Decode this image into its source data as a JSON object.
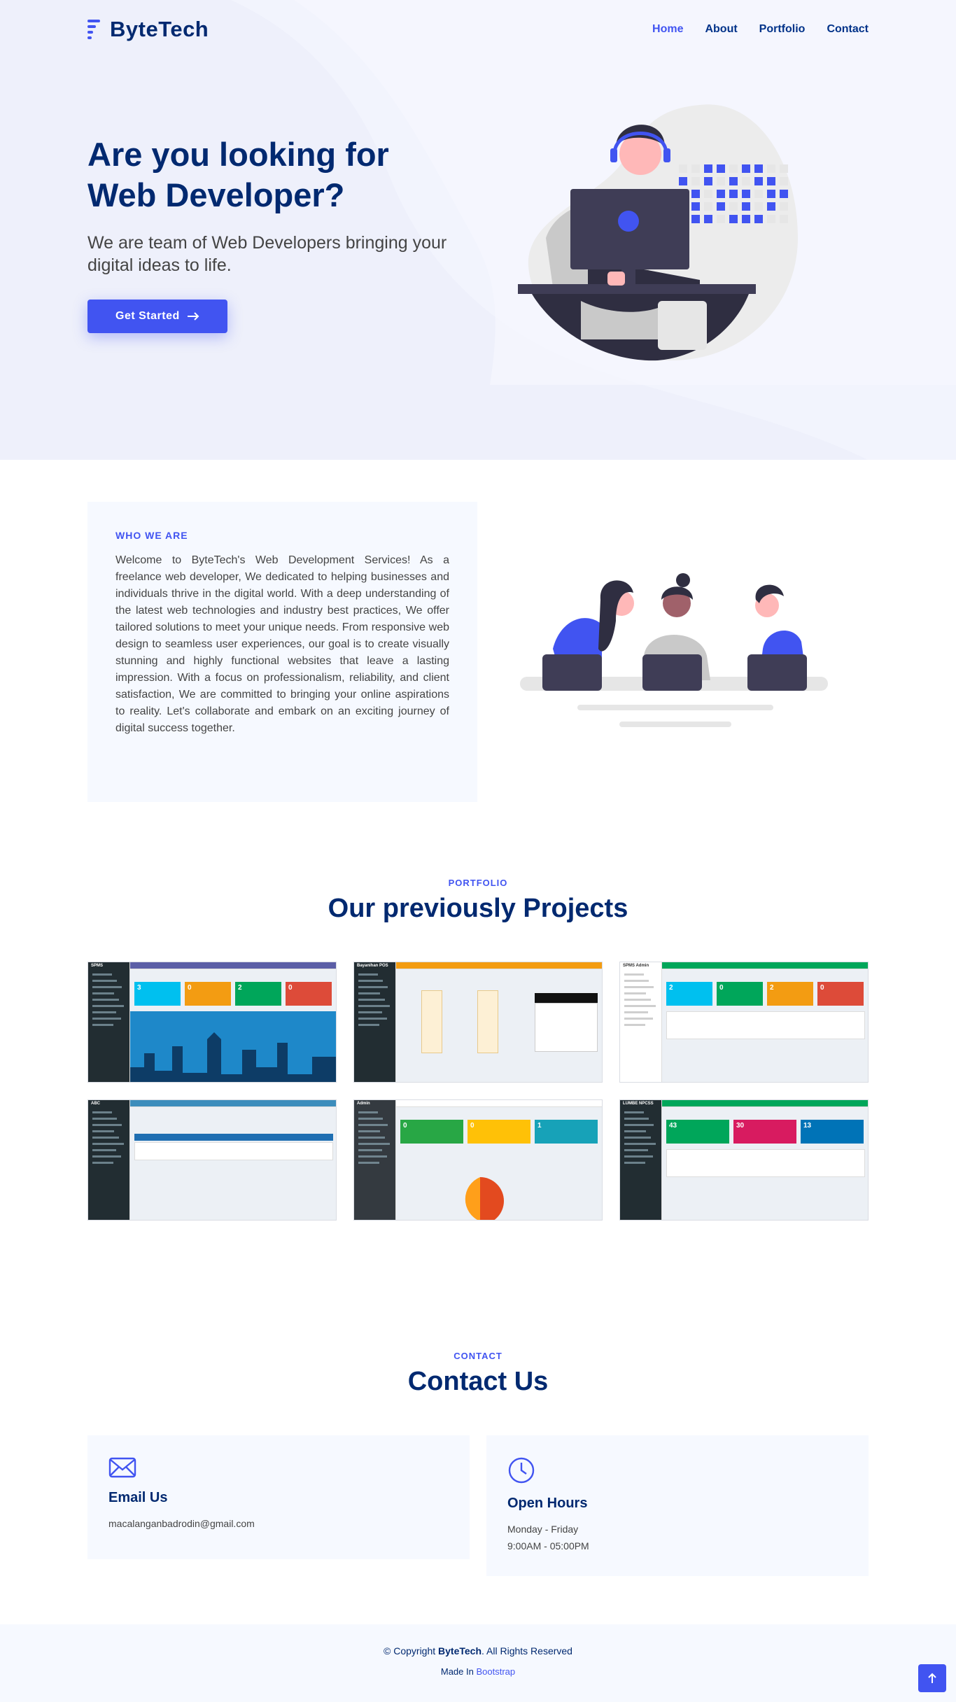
{
  "brand": {
    "name": "ByteTech"
  },
  "nav": [
    {
      "label": "Home",
      "active": true
    },
    {
      "label": "About",
      "active": false
    },
    {
      "label": "Portfolio",
      "active": false
    },
    {
      "label": "Contact",
      "active": false
    }
  ],
  "hero": {
    "title_line1": "Are you looking for",
    "title_line2": "Web Developer?",
    "subtitle": "We are team of Web Developers bringing your digital ideas to life.",
    "cta": "Get Started"
  },
  "about": {
    "tag": "WHO WE ARE",
    "text": "Welcome to ByteTech's Web Development Services! As a freelance web developer, We dedicated to helping businesses and individuals thrive in the digital world. With a deep understanding of the latest web technologies and industry best practices, We offer tailored solutions to meet your unique needs. From responsive web design to seamless user experiences, our goal is to create visually stunning and highly functional websites that leave a lasting impression. With a focus on professionalism, reliability, and client satisfaction, We are committed to bringing your online aspirations to reality. Let's collaborate and embark on an exciting journey of digital success together."
  },
  "portfolio": {
    "tag": "PORTFOLIO",
    "title": "Our previously Projects",
    "projects": [
      {
        "sidebar_title": "SPMS",
        "header": "#5b5ea6",
        "sidebar": "#222d32",
        "cards": [
          {
            "n": "3",
            "c": "#00c0ef"
          },
          {
            "n": "0",
            "c": "#f39c12"
          },
          {
            "n": "2",
            "c": "#00a65a"
          },
          {
            "n": "0",
            "c": "#dd4b39"
          }
        ]
      },
      {
        "sidebar_title": "Bayanihan POS",
        "header": "#f39c12",
        "sidebar": "#222d32",
        "cards": []
      },
      {
        "sidebar_title": "SPMS Admin",
        "header": "#00a65a",
        "sidebar": "#ffffff",
        "cards": [
          {
            "n": "2",
            "c": "#00c0ef"
          },
          {
            "n": "0",
            "c": "#00a65a"
          },
          {
            "n": "2",
            "c": "#f39c12"
          },
          {
            "n": "0",
            "c": "#dd4b39"
          }
        ]
      },
      {
        "sidebar_title": "ABC",
        "header": "#3c8dbc",
        "sidebar": "#222d32",
        "cards": []
      },
      {
        "sidebar_title": "Admin",
        "header": "#ffffff",
        "sidebar": "#343a40",
        "cards": [
          {
            "n": "0",
            "c": "#28a745"
          },
          {
            "n": "0",
            "c": "#ffc107"
          },
          {
            "n": "1",
            "c": "#17a2b8"
          }
        ]
      },
      {
        "sidebar_title": "LUMBE NPCSS",
        "header": "#00a65a",
        "sidebar": "#222d32",
        "cards": [
          {
            "n": "43",
            "c": "#00a65a"
          },
          {
            "n": "30",
            "c": "#d81b60"
          },
          {
            "n": "13",
            "c": "#0073b7"
          }
        ]
      }
    ]
  },
  "contact": {
    "tag": "CONTACT",
    "title": "Contact Us",
    "email_title": "Email Us",
    "email": "macalanganbadrodin@gmail.com",
    "hours_title": "Open Hours",
    "hours_days": "Monday - Friday",
    "hours_time": "9:00AM - 05:00PM"
  },
  "footer": {
    "copy_prefix": "© Copyright",
    "copy_brand": "ByteTech",
    "copy_suffix": ". All Rights Reserved",
    "made_in": "Made In",
    "made_link": "Bootstrap"
  },
  "icons": {
    "logo": "bars-logo-icon",
    "cta_arrow": "arrow-right-icon",
    "email": "envelope-icon",
    "hours": "clock-icon",
    "back_top": "arrow-up-icon"
  }
}
